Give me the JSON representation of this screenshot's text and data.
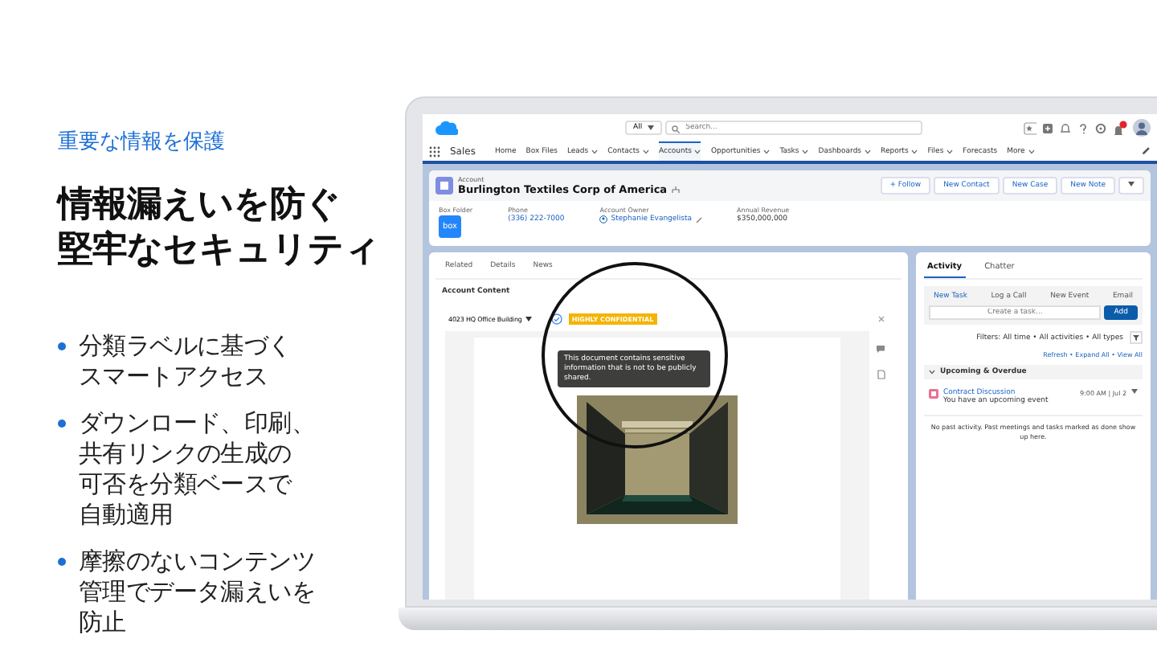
{
  "slide": {
    "eyebrow": "重要な情報を保護",
    "title_lines": [
      "情報漏えいを防ぐ",
      "堅牢なセキュリティ"
    ],
    "bullets": [
      [
        "分類ラベルに基づく",
        "スマートアクセス"
      ],
      [
        "ダウンロード、印刷、",
        "共有リンクの生成の",
        "可否を分類ベースで",
        "自動適用"
      ],
      [
        "摩擦のないコンテンツ",
        "管理でデータ漏えいを",
        "防止"
      ]
    ]
  },
  "app": {
    "search": {
      "scope": "All",
      "placeholder": "Search..."
    },
    "app_name": "Sales",
    "nav": [
      {
        "label": "Home",
        "dropdown": false,
        "selected": false
      },
      {
        "label": "Box Files",
        "dropdown": false,
        "selected": false
      },
      {
        "label": "Leads",
        "dropdown": true,
        "selected": false
      },
      {
        "label": "Contacts",
        "dropdown": true,
        "selected": false
      },
      {
        "label": "Accounts",
        "dropdown": true,
        "selected": true
      },
      {
        "label": "Opportunities",
        "dropdown": true,
        "selected": false
      },
      {
        "label": "Tasks",
        "dropdown": true,
        "selected": false
      },
      {
        "label": "Dashboards",
        "dropdown": true,
        "selected": false
      },
      {
        "label": "Reports",
        "dropdown": true,
        "selected": false
      },
      {
        "label": "Files",
        "dropdown": true,
        "selected": false
      },
      {
        "label": "Forecasts",
        "dropdown": false,
        "selected": false
      },
      {
        "label": "More",
        "dropdown": true,
        "selected": false
      }
    ],
    "record": {
      "object": "Account",
      "name": "Burlington Textiles Corp of America",
      "actions": [
        "+ Follow",
        "New Contact",
        "New Case",
        "New Note"
      ],
      "fields": [
        {
          "label": "Box Folder",
          "kind": "logo",
          "value": "box"
        },
        {
          "label": "Phone",
          "kind": "link",
          "value": "(336) 222-7000"
        },
        {
          "label": "Account Owner",
          "kind": "user",
          "value": "Stephanie Evangelista"
        },
        {
          "label": "Annual Revenue",
          "kind": "text",
          "value": "$350,000,000"
        }
      ]
    },
    "tabs": [
      "Related",
      "Details",
      "News"
    ],
    "section_title": "Account Content",
    "viewer": {
      "file_name": "4023 HQ Office Building",
      "label": "HIGHLY CONFIDENTIAL",
      "tooltip": "This document contains sensitive information that is not to be publicly shared."
    },
    "activity": {
      "tabs": [
        {
          "label": "Activity",
          "selected": true
        },
        {
          "label": "Chatter",
          "selected": false
        }
      ],
      "subtabs": [
        {
          "label": "New Task",
          "selected": true
        },
        {
          "label": "Log a Call",
          "selected": false
        },
        {
          "label": "New Event",
          "selected": false
        },
        {
          "label": "Email",
          "selected": false
        }
      ],
      "task_placeholder": "Create a task...",
      "add": "Add",
      "filters": "Filters: All time • All activities • All types",
      "links": "Refresh • Expand All • View All",
      "section": "Upcoming & Overdue",
      "events": [
        {
          "title": "Contract Discussion",
          "subtitle": "You have an upcoming event",
          "time": "9:00 AM | Jul 2"
        }
      ],
      "empty": "No past activity. Past meetings and tasks marked as done show up here."
    }
  }
}
